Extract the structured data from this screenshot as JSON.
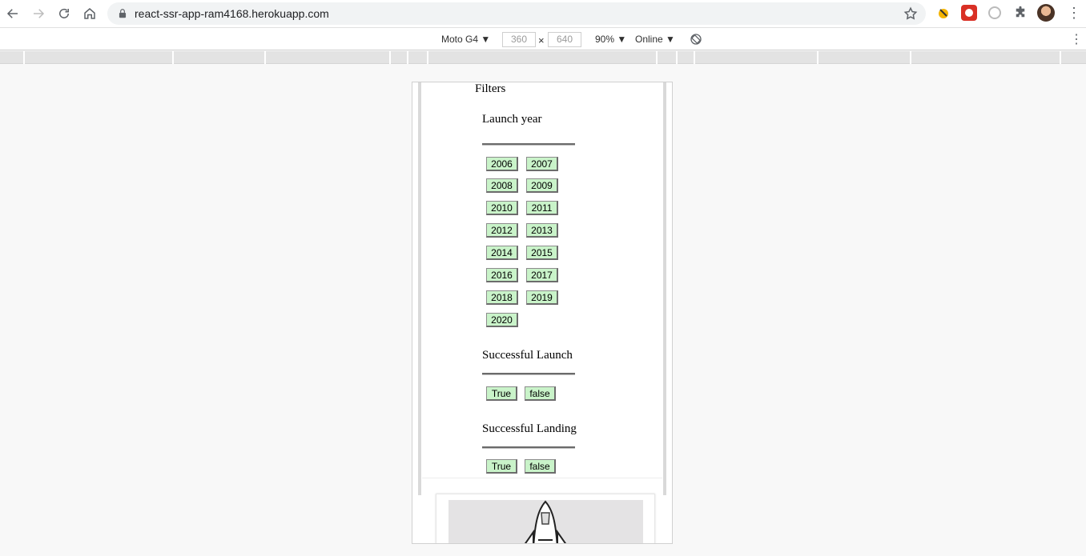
{
  "browser": {
    "url": "react-ssr-app-ram4168.herokuapp.com"
  },
  "device_toolbar": {
    "device": "Moto G4 ▼",
    "width": "360",
    "times": "×",
    "height": "640",
    "zoom": "90% ▼",
    "network": "Online ▼"
  },
  "app": {
    "filters_title": "Filters",
    "launch_year": {
      "title": "Launch year",
      "years": [
        "2006",
        "2007",
        "2008",
        "2009",
        "2010",
        "2011",
        "2012",
        "2013",
        "2014",
        "2015",
        "2016",
        "2017",
        "2018",
        "2019",
        "2020"
      ]
    },
    "successful_launch": {
      "title": "Successful Launch",
      "true_label": "True",
      "false_label": "false"
    },
    "successful_landing": {
      "title": "Successful Landing",
      "true_label": "True",
      "false_label": "false"
    }
  },
  "colors": {
    "chip_bg": "#c9f3c9",
    "page_bg": "#f8f8f8"
  }
}
